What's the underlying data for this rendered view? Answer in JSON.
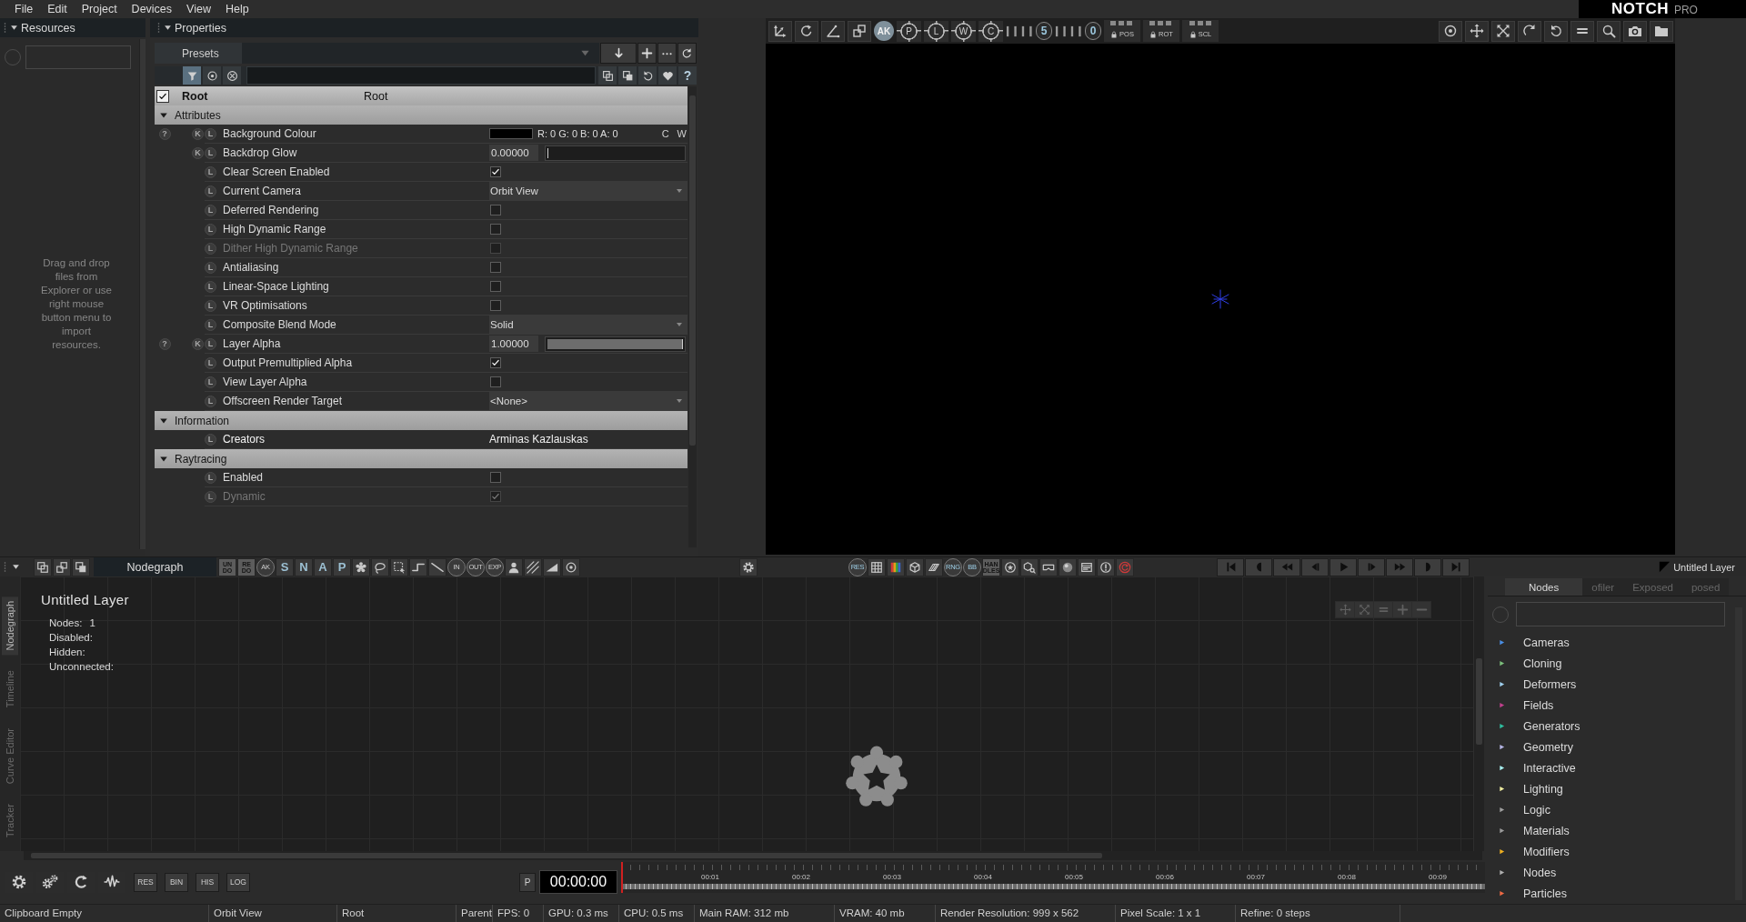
{
  "menu": [
    "File",
    "Edit",
    "Project",
    "Devices",
    "View",
    "Help"
  ],
  "logo": {
    "name": "NOTCH",
    "edition": "PRO"
  },
  "resources": {
    "title": "Resources",
    "hint": "Drag and drop files from Explorer or use right mouse button menu to import resources."
  },
  "properties": {
    "title": "Properties",
    "presets": "Presets",
    "filter_on": true,
    "help_button": "?",
    "root": {
      "checked": true,
      "name": "Root",
      "type": "Root"
    },
    "sections": [
      {
        "title": "Attributes",
        "expanded": true,
        "rows": [
          {
            "label": "Background Colour",
            "kind": "color",
            "help": "?",
            "key": "K",
            "link": "L",
            "color": "#000000",
            "value": "R: 0 G: 0 B: 0 A: 0",
            "buttons": [
              "C",
              "W"
            ],
            "disabled": false
          },
          {
            "label": "Backdrop Glow",
            "kind": "slider",
            "key": "K",
            "link": "L",
            "value": "0.00000",
            "level": 0,
            "disabled": false
          },
          {
            "label": "Clear Screen Enabled",
            "kind": "check",
            "link": "L",
            "checked": true,
            "disabled": false
          },
          {
            "label": "Current Camera",
            "kind": "dropdown",
            "link": "L",
            "value": "Orbit View",
            "disabled": false
          },
          {
            "label": "Deferred Rendering",
            "kind": "check",
            "link": "L",
            "checked": false,
            "disabled": false
          },
          {
            "label": "High Dynamic Range",
            "kind": "check",
            "link": "L",
            "checked": false,
            "disabled": false
          },
          {
            "label": "Dither High Dynamic Range",
            "kind": "check",
            "link": "L",
            "checked": false,
            "disabled": true
          },
          {
            "label": "Antialiasing",
            "kind": "check",
            "link": "L",
            "checked": false,
            "disabled": false
          },
          {
            "label": "Linear-Space Lighting",
            "kind": "check",
            "link": "L",
            "checked": false,
            "disabled": false
          },
          {
            "label": "VR Optimisations",
            "kind": "check",
            "link": "L",
            "checked": false,
            "disabled": false
          },
          {
            "label": "Composite Blend Mode",
            "kind": "dropdown",
            "link": "L",
            "value": "Solid",
            "disabled": false
          },
          {
            "label": "Layer Alpha",
            "kind": "slider",
            "help": "?",
            "key": "K",
            "link": "L",
            "value": "1.00000",
            "level": 1,
            "disabled": false
          },
          {
            "label": "Output Premultiplied Alpha",
            "kind": "check",
            "link": "L",
            "checked": true,
            "disabled": false
          },
          {
            "label": "View Layer Alpha",
            "kind": "check",
            "link": "L",
            "checked": false,
            "disabled": false
          },
          {
            "label": "Offscreen Render Target",
            "kind": "dropdown",
            "link": "L",
            "value": "<None>",
            "disabled": false
          }
        ]
      },
      {
        "title": "Information",
        "expanded": true,
        "rows": [
          {
            "label": "Creators",
            "kind": "text",
            "link": "L",
            "value": "Arminas Kazlauskas",
            "disabled": false
          }
        ]
      },
      {
        "title": "Raytracing",
        "expanded": true,
        "rows": [
          {
            "label": "Enabled",
            "kind": "check",
            "link": "L",
            "checked": false,
            "disabled": false
          },
          {
            "label": "Dynamic",
            "kind": "check",
            "link": "L",
            "checked": true,
            "disabled": true
          }
        ]
      }
    ]
  },
  "viewport_toolbar": {
    "tools": [
      {
        "kind": "marker",
        "label": "AK"
      },
      {
        "kind": "target",
        "label": "P"
      },
      {
        "kind": "target",
        "label": "L"
      },
      {
        "kind": "target",
        "label": "W"
      },
      {
        "kind": "target",
        "label": "C"
      },
      {
        "kind": "counter",
        "label": "5"
      },
      {
        "kind": "counter",
        "label": "0"
      },
      {
        "kind": "lock",
        "label": "POS"
      },
      {
        "kind": "lock",
        "label": "ROT"
      },
      {
        "kind": "lock",
        "label": "SCL"
      }
    ]
  },
  "nodegraph_toolbar": {
    "title": "Nodegraph",
    "edit_tools": [
      {
        "kind": "stacked",
        "label": "UN DO"
      },
      {
        "kind": "stacked",
        "label": "RE DO"
      },
      {
        "kind": "circled",
        "label": "AK"
      },
      {
        "kind": "letter",
        "label": "S"
      },
      {
        "kind": "letter",
        "label": "N"
      },
      {
        "kind": "letter",
        "label": "A"
      },
      {
        "kind": "letter",
        "label": "P"
      }
    ],
    "port_tools": [
      {
        "kind": "circled",
        "label": "IN"
      },
      {
        "kind": "circled",
        "label": "OUT"
      },
      {
        "kind": "circled",
        "label": "EXP"
      }
    ]
  },
  "render_toolbar": {
    "tools": [
      {
        "kind": "circled",
        "label": "RES"
      },
      {
        "kind": "circled",
        "label": "RNG"
      },
      {
        "kind": "circled",
        "label": "BB"
      },
      {
        "kind": "stacked",
        "label": "HAN DLES"
      }
    ]
  },
  "layer_label": "Untitled Layer",
  "nodegraph": {
    "side_tabs": [
      {
        "label": "Nodegraph",
        "selected": true
      },
      {
        "label": "Timeline",
        "selected": false
      },
      {
        "label": "Curve Editor",
        "selected": false
      },
      {
        "label": "Tracker",
        "selected": false
      }
    ],
    "title": "Untitled Layer",
    "stats": [
      {
        "label": "Nodes:",
        "value": "1"
      },
      {
        "label": "Disabled:"
      },
      {
        "label": "Hidden:"
      },
      {
        "label": "Unconnected:"
      }
    ]
  },
  "bottom_bar": {
    "buttons": [
      "RES",
      "BIN",
      "HIS",
      "LOG"
    ],
    "mode": "P",
    "time": "00:00:00",
    "ruler": [
      "00:01",
      "00:02",
      "00:03",
      "00:04",
      "00:05",
      "00:06",
      "00:07",
      "00:08",
      "00:09"
    ]
  },
  "library": {
    "tabs": [
      {
        "label": "Nodes",
        "selected": true
      },
      {
        "label": "ofiler",
        "selected": false
      },
      {
        "label": "Exposed",
        "selected": false
      },
      {
        "label": "posed",
        "selected": false
      }
    ],
    "categories": [
      {
        "name": "Cameras",
        "color": "#4a8fe6"
      },
      {
        "name": "Cloning",
        "color": "#7cbf7c"
      },
      {
        "name": "Deformers",
        "color": "#9fd0ee"
      },
      {
        "name": "Fields",
        "color": "#c2408e"
      },
      {
        "name": "Generators",
        "color": "#2fbfa0"
      },
      {
        "name": "Geometry",
        "color": "#b4b4e4"
      },
      {
        "name": "Interactive",
        "color": "#a8f0f0"
      },
      {
        "name": "Lighting",
        "color": "#f0eea0"
      },
      {
        "name": "Logic",
        "color": "#a0a0a0"
      },
      {
        "name": "Materials",
        "color": "#9c9c9c"
      },
      {
        "name": "Modifiers",
        "color": "#f0b020"
      },
      {
        "name": "Nodes",
        "color": "#b0b0b0"
      },
      {
        "name": "Particles",
        "color": "#f06a44"
      }
    ]
  },
  "status_bar": [
    "Clipboard Empty",
    "Orbit View",
    "Root",
    "Parent",
    "FPS: 0",
    "GPU: 0.3 ms",
    "CPU: 0.5 ms",
    "Main RAM: 312 mb",
    "VRAM: 40 mb",
    "Render Resolution: 999 x 562",
    "Pixel Scale: 1 x 1",
    "Refine: 0 steps"
  ]
}
